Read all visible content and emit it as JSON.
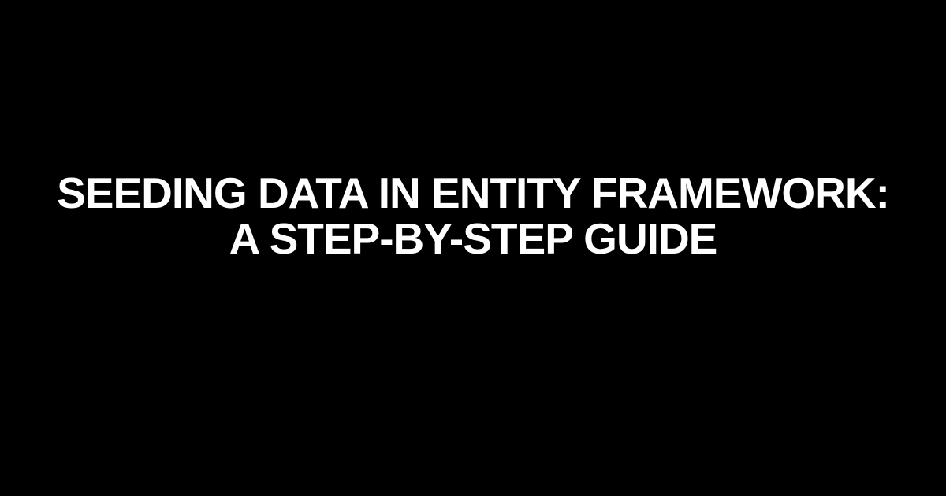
{
  "title": "Seeding Data in Entity Framework: A Step-by-Step Guide"
}
